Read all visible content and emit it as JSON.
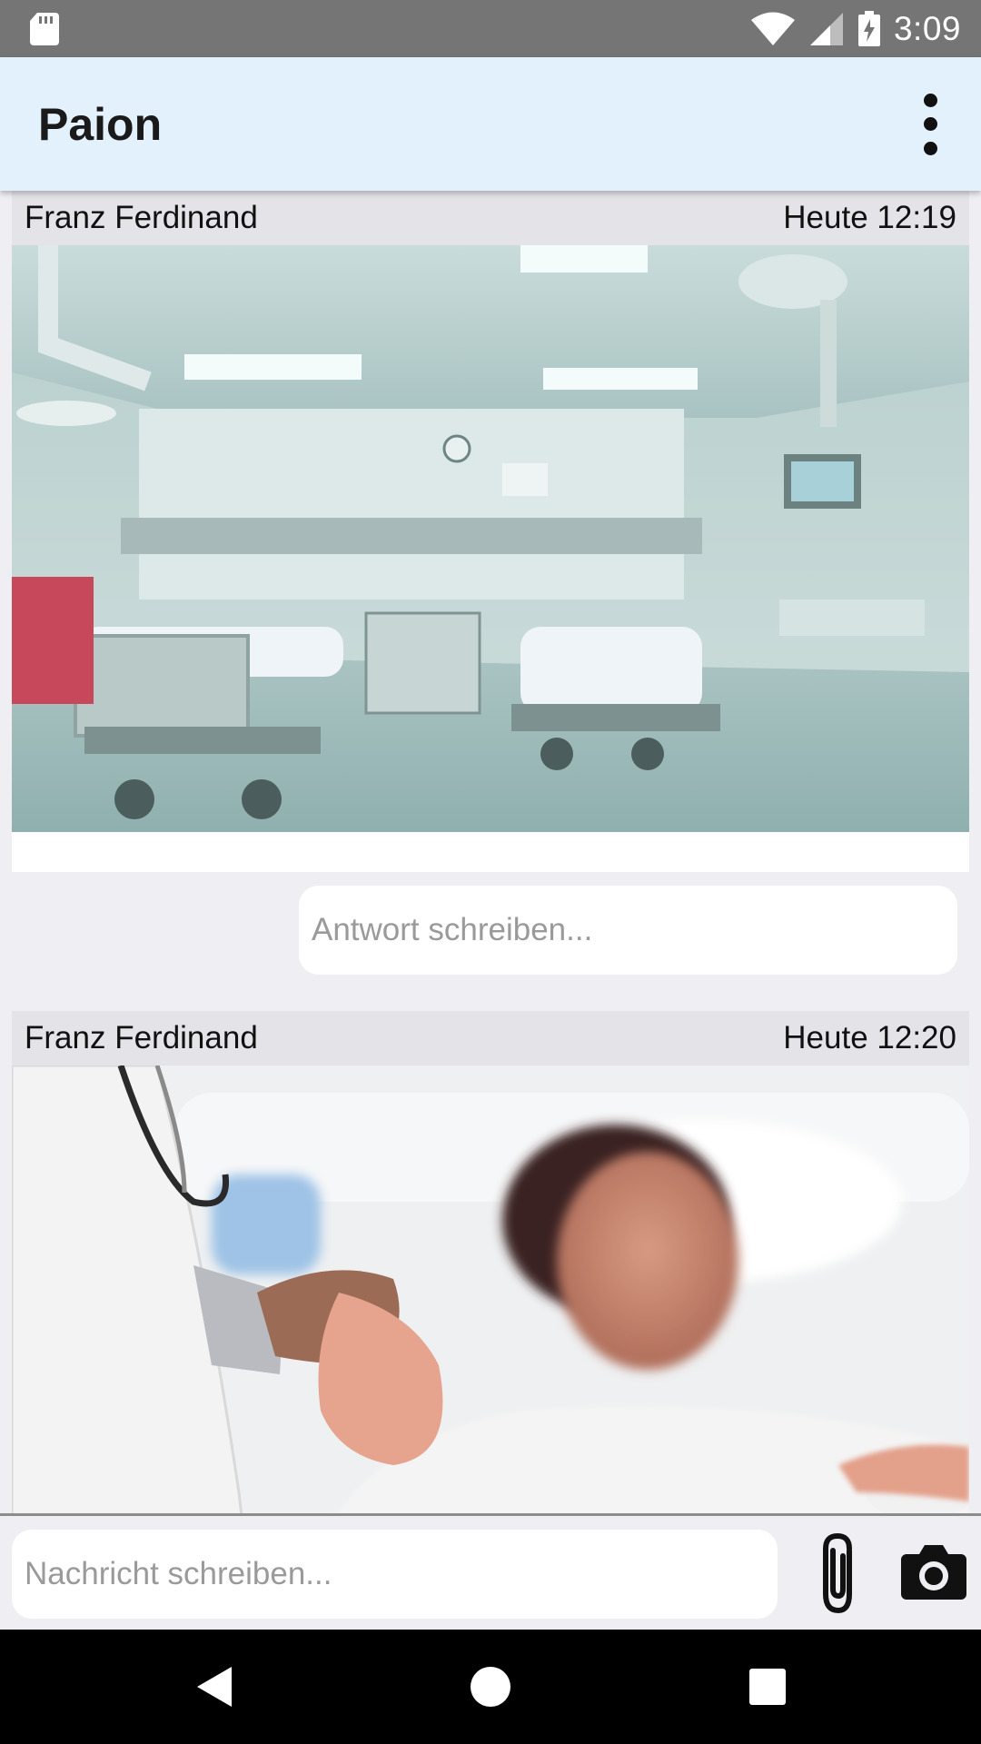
{
  "status_bar": {
    "time": "3:09",
    "icons": [
      "sd-card-icon",
      "wifi-icon",
      "signal-icon",
      "battery-charging-icon"
    ]
  },
  "app_bar": {
    "title": "Paion",
    "menu_icon": "more-vert-icon"
  },
  "posts": [
    {
      "author": "Franz Ferdinand",
      "time": "Heute 12:19",
      "image": "hospital-room-image",
      "reply_placeholder": "Antwort schreiben..."
    },
    {
      "author": "Franz Ferdinand",
      "time": "Heute 12:20",
      "image": "doctor-patient-image"
    }
  ],
  "composer": {
    "placeholder": "Nachricht schreiben...",
    "attach_icon": "paperclip-icon",
    "camera_icon": "camera-icon"
  },
  "nav_bar": {
    "icons": [
      "back-icon",
      "home-icon",
      "recents-icon"
    ]
  }
}
